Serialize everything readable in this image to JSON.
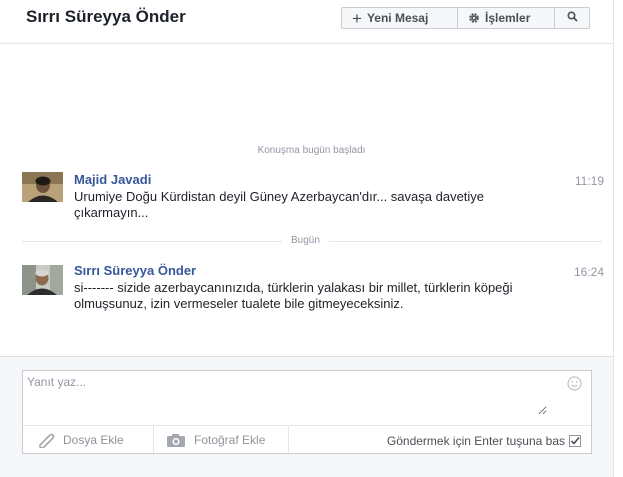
{
  "header": {
    "title": "Sırrı Süreyya Önder",
    "new_message": "Yeni Mesaj",
    "actions": "İşlemler"
  },
  "conversation": {
    "started_label": "Konuşma bugün başladı",
    "today_label": "Bugün",
    "messages": [
      {
        "sender": "Majid Javadi",
        "time": "11:19",
        "text": "Urumiye Doğu Kürdistan deyil Güney Azerbaycan'dır... savaşa davetiye çıkarmayın..."
      },
      {
        "sender": "Sırrı Süreyya Önder",
        "time": "16:24",
        "text": "si-------    sizide azerbaycanınızıda, türklerin yalakası bir millet, türklerin köpeği olmuşsunuz, izin vermeseler tualete bile gitmeyeceksiniz."
      }
    ]
  },
  "composer": {
    "placeholder": "Yanıt yaz...",
    "add_file": "Dosya Ekle",
    "add_photo": "Fotoğraf Ekle",
    "enter_to_send": "Göndermek için Enter tuşuna bas",
    "enter_to_send_checked": true
  },
  "colors": {
    "link_blue": "#365899",
    "meta_gray": "#9197a3",
    "panel_bg": "#f6f7f9"
  }
}
